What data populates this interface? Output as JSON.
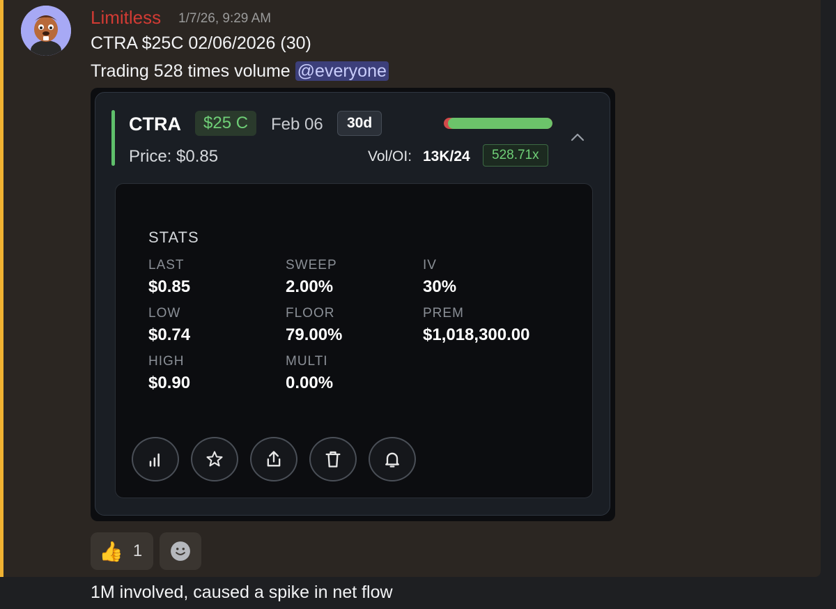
{
  "message": {
    "username": "Limitless",
    "timestamp": "1/7/26, 9:29 AM",
    "line1": "CTRA $25C 02/06/2026 (30)",
    "line2_text": "Trading 528 times volume ",
    "mention": "@everyone"
  },
  "card": {
    "ticker": "CTRA",
    "strike": "$25 C",
    "expiry": "Feb 06",
    "days": "30d",
    "price": "Price: $0.85",
    "voloi_label": "Vol/OI:",
    "voloi_value": "13K/24",
    "ratio": "528.71x",
    "sentiment_bullish_fraction": 0.96,
    "colors": {
      "bullish": "#6cc36a",
      "bearish": "#d24a4a",
      "accent": "#5fbf6b"
    }
  },
  "stats": {
    "title": "STATS",
    "items": [
      {
        "label": "LAST",
        "value": "$0.85"
      },
      {
        "label": "SWEEP",
        "value": "2.00%"
      },
      {
        "label": "IV",
        "value": "30%"
      },
      {
        "label": "LOW",
        "value": "$0.74"
      },
      {
        "label": "FLOOR",
        "value": "79.00%"
      },
      {
        "label": "PREM",
        "value": "$1,018,300.00"
      },
      {
        "label": "HIGH",
        "value": "$0.90"
      },
      {
        "label": "MULTI",
        "value": "0.00%"
      }
    ]
  },
  "actions": [
    "chart-icon",
    "star-icon",
    "share-icon",
    "trash-icon",
    "bell-icon"
  ],
  "reaction": {
    "emoji": "👍",
    "count": "1"
  },
  "caption": "1M involved, caused a spike in net flow"
}
